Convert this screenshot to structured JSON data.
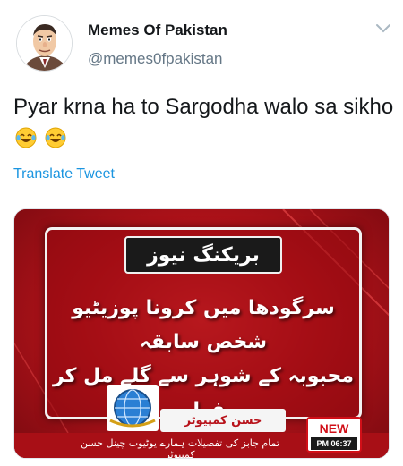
{
  "tweet": {
    "author_name": "Memes Of Pakistan",
    "author_handle": "@memes0fpakistan",
    "text": "Pyar krna ha to Sargodha walo sa sikho",
    "emojis": [
      "face-with-tears-of-joy",
      "face-with-tears-of-joy"
    ],
    "translate_label": "Translate Tweet"
  },
  "media": {
    "breaking_label": "بریکنگ نیوز",
    "headline_line1": "سرگودھا میں کرونا پوزیٹیو شخص سابقہ",
    "headline_line2": "محبوبہ کے شوہر سے گلے مل کر فرار",
    "channel_caption": "حسن کمپیوٹر",
    "ticker": "تمام جابز کی تفصیلات ہمارے یوٹیوب چینل حسن کمپیوٹر",
    "new_badge": "NEW",
    "clock": "PM 06:37"
  },
  "colors": {
    "link": "#1b95e0",
    "handle": "#657786",
    "news_red": "#b8121a"
  }
}
